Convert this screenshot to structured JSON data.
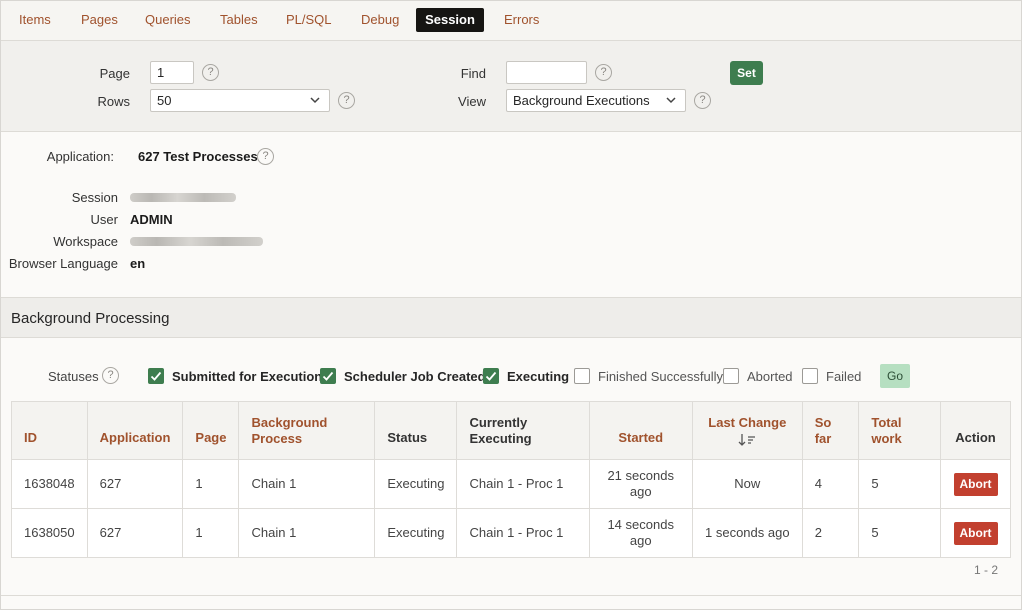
{
  "tabs": [
    {
      "label": "Items"
    },
    {
      "label": "Pages"
    },
    {
      "label": "Queries"
    },
    {
      "label": "Tables"
    },
    {
      "label": "PL/SQL"
    },
    {
      "label": "Debug"
    },
    {
      "label": "Session",
      "active": true
    },
    {
      "label": "Errors"
    }
  ],
  "filters": {
    "page_label": "Page",
    "page_value": "1",
    "rows_label": "Rows",
    "rows_value": "50",
    "find_label": "Find",
    "find_value": "",
    "view_label": "View",
    "view_value": "Background Executions",
    "set_label": "Set",
    "help_glyph": "?"
  },
  "session_info": {
    "application_label": "Application:",
    "application_value": "627 Test Processes",
    "session_label": "Session",
    "user_label": "User",
    "user_value": "ADMIN",
    "workspace_label": "Workspace",
    "browser_language_label": "Browser Language",
    "browser_language_value": "en"
  },
  "region": {
    "title": "Background Processing"
  },
  "statuses": {
    "label": "Statuses",
    "options": [
      {
        "label": "Submitted for Execution",
        "checked": true
      },
      {
        "label": "Scheduler Job Created",
        "checked": true
      },
      {
        "label": "Executing",
        "checked": true
      },
      {
        "label": "Finished Successfully",
        "checked": false
      },
      {
        "label": "Aborted",
        "checked": false
      },
      {
        "label": "Failed",
        "checked": false
      }
    ],
    "go_label": "Go"
  },
  "table": {
    "headers": {
      "id": "ID",
      "application": "Application",
      "page": "Page",
      "background_process_1": "Background",
      "background_process_2": "Process",
      "status": "Status",
      "currently_executing_1": "Currently",
      "currently_executing_2": "Executing",
      "started": "Started",
      "last_change": "Last Change",
      "so_far_1": "So",
      "so_far_2": "far",
      "total_work_1": "Total",
      "total_work_2": "work",
      "action": "Action"
    },
    "rows": [
      {
        "id": "1638048",
        "application": "627",
        "page": "1",
        "process": "Chain 1",
        "status": "Executing",
        "executing": "Chain 1 - Proc 1",
        "started_1": "21 seconds",
        "started_2": "ago",
        "last_change": "Now",
        "so_far": "4",
        "total_work": "5",
        "action": "Abort"
      },
      {
        "id": "1638050",
        "application": "627",
        "page": "1",
        "process": "Chain 1",
        "status": "Executing",
        "executing": "Chain 1 - Proc 1",
        "started_1": "14 seconds",
        "started_2": "ago",
        "last_change": "1 seconds ago",
        "so_far": "2",
        "total_work": "5",
        "action": "Abort"
      }
    ],
    "pagination": "1 - 2"
  },
  "colors": {
    "accent_link": "#a0522d",
    "active_tab_bg": "#161513",
    "set_button": "#3e7d4f",
    "checkbox_checked": "#3e7d4f",
    "go_button": "#b6dfc1",
    "abort_button": "#c2402f"
  },
  "icons": {
    "help": "help-circle-icon",
    "dropdown": "chevron-down-icon",
    "checked": "check-icon",
    "sort": "sort-descending-icon"
  }
}
